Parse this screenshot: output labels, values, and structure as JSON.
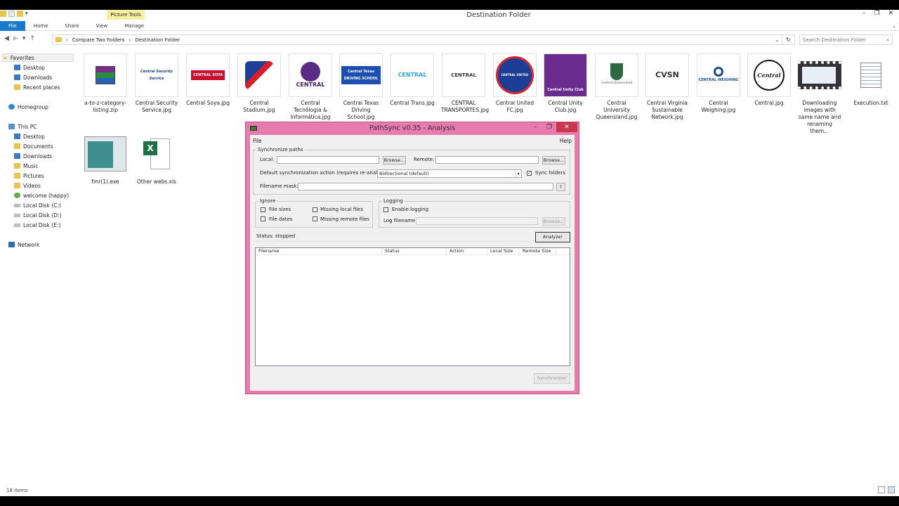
{
  "window": {
    "title": "Destination Folder",
    "context_tab": "Picture Tools",
    "min": "–",
    "max": "❐",
    "close": "✕"
  },
  "ribbon": {
    "tabs": [
      "File",
      "Home",
      "Share",
      "View",
      "Manage"
    ],
    "expand": "⌄"
  },
  "address": {
    "crumbs": [
      "Compare Two Folders",
      "Destination Folder"
    ],
    "separator": "›",
    "dropdown": "⌄",
    "refresh": "↻",
    "search_placeholder": "Search Destination Folder",
    "search_icon": "⌕"
  },
  "nav_pane": {
    "favorites": "Favorites",
    "desktop": "Desktop",
    "downloads": "Downloads",
    "recent": "Recent places",
    "homegroup": "Homegroup",
    "thispc": "This PC",
    "pc_desktop": "Desktop",
    "documents": "Documents",
    "pc_downloads": "Downloads",
    "music": "Music",
    "pictures": "Pictures",
    "videos": "Videos",
    "welcome": "welcome (happy)",
    "disk_c": "Local Disk (C:)",
    "disk_d": "Local Disk (D:)",
    "disk_e": "Local Disk (E:)",
    "network": "Network"
  },
  "files": {
    "f1": "a-to-z-category-listing.zip",
    "f2": "Central Security Service.jpg",
    "f3": "Central Soya.jpg",
    "f4": "Central Stadium.jpg",
    "f5": "Central Tecnólogia & Informática.jpg",
    "f6": "Central Texas Driving School.jpg",
    "f7": "Central Trans.jpg",
    "f8": "CENTRAL TRANSPORTES.jpg",
    "f9": "Central United FC.jpg",
    "f10": "Central Unity Club.jpg",
    "f11": "Central University Queensland.jpg",
    "f12": "Central Virginia Sustainable Network.jpg",
    "f13": "Central Weighing.jpg",
    "f14": "Central.jpg",
    "f15": "Downloading images with same name and renaming them...",
    "f16": "Execution.txt",
    "f17": "fmr(1).exe",
    "f18": "Other webs.xls"
  },
  "logos": {
    "security": "Central Security Service",
    "soya": "CENTRAL SOYA",
    "tecno": "CENTRAL",
    "texas": "Central Texas DRIVING SCHOOL",
    "trans": "CENTRAL",
    "transportes": "CENTRAL",
    "united": "CENTRAL UNITED",
    "unity": "Central Unity Club",
    "queensland": "Central Queensland",
    "virginia": "CVSN",
    "weighing": "CENTRAL WEIGHING",
    "central": "Central"
  },
  "status_bar": {
    "items": "18 items"
  },
  "dialog": {
    "title": "PathSync v0.35 - Analysis",
    "menu_file": "File",
    "menu_help": "Help",
    "sync_group": "Synchronize paths",
    "local_label": "Local:",
    "browse": "Browse...",
    "remote_label": "Remote:",
    "default_action_label": "Default synchronization action (requires re-analyze):",
    "default_action_value": "Bidirectional (default)",
    "sync_folders": "Sync folders",
    "filename_mask": "Filename mask:",
    "mask_help": "?",
    "ignore_group": "Ignore",
    "file_sizes": "File sizes",
    "file_dates": "File dates",
    "missing_local": "Missing local files",
    "missing_remote": "Missing remote files",
    "logging_group": "Logging",
    "enable_logging": "Enable logging",
    "log_filename": "Log filename:",
    "status": "Status: stopped",
    "analyze": "Analyze!",
    "columns": [
      "Filename",
      "Status",
      "Action",
      "Local Size",
      "Remote Size"
    ],
    "synchronize": "Synchronize!"
  },
  "colors": {
    "accent": "#1979ca",
    "dialog_frame": "#e77bab",
    "close_red": "#c7394b"
  }
}
